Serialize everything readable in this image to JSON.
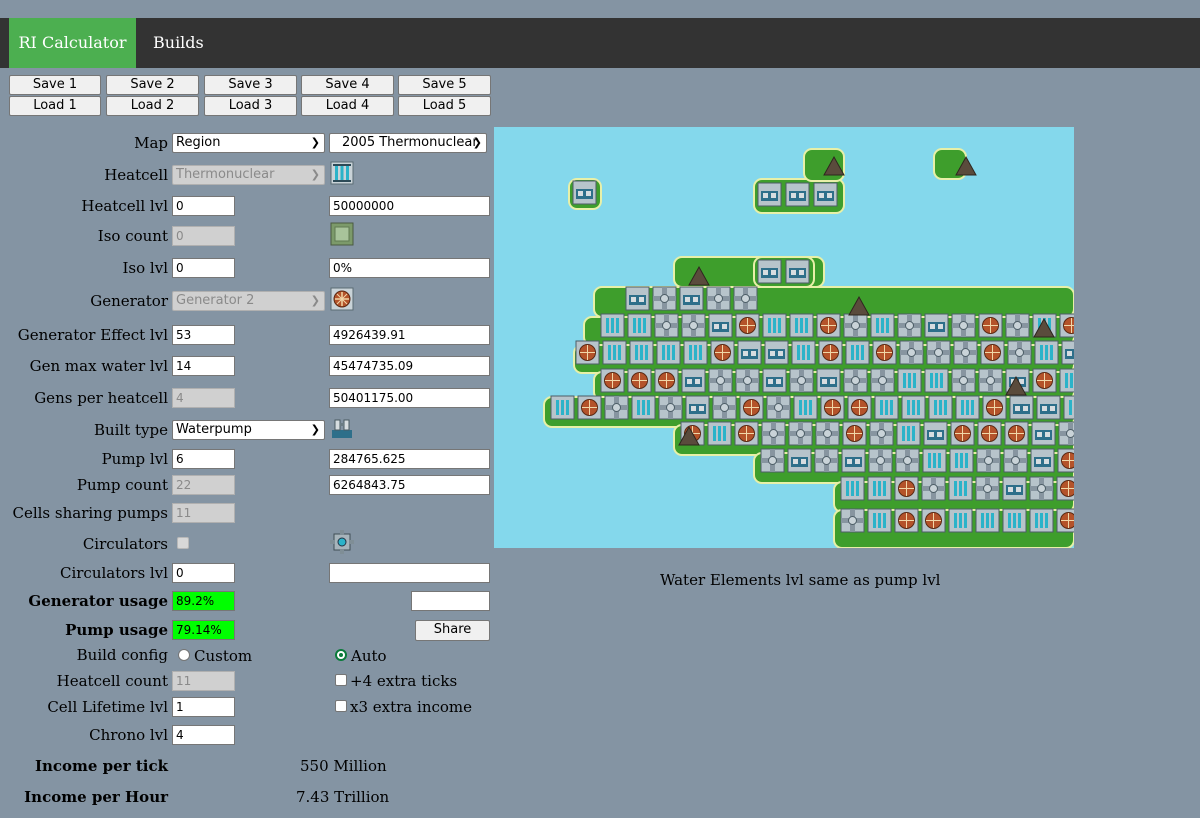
{
  "nav": {
    "calculator": "RI Calculator",
    "builds": "Builds"
  },
  "saves": [
    "Save 1",
    "Save 2",
    "Save 3",
    "Save 4",
    "Save 5"
  ],
  "loads": [
    "Load 1",
    "Load 2",
    "Load 3",
    "Load 4",
    "Load 5"
  ],
  "map": {
    "label": "Map",
    "type": "Region",
    "preset": "2005 Thermonuclear"
  },
  "heatcell": {
    "label": "Heatcell",
    "value": "Thermonuclear",
    "icon": "heatcell-icon"
  },
  "heatcell_lvl": {
    "label": "Heatcell lvl",
    "value": "0",
    "result": "50000000"
  },
  "iso_count": {
    "label": "Iso count",
    "value": "0",
    "icon": "isolator-icon"
  },
  "iso_lvl": {
    "label": "Iso lvl",
    "value": "0",
    "result": "0%"
  },
  "generator": {
    "label": "Generator",
    "value": "Generator 2",
    "icon": "generator-icon"
  },
  "gen_effect": {
    "label": "Generator Effect lvl",
    "value": "53",
    "result": "4926439.91"
  },
  "gen_water": {
    "label": "Gen max water lvl",
    "value": "14",
    "result": "45474735.09"
  },
  "gens_per_cell": {
    "label": "Gens per heatcell",
    "value": "4",
    "result": "50401175.00"
  },
  "built_type": {
    "label": "Built type",
    "value": "Waterpump",
    "icon": "waterpump-icon"
  },
  "pump_lvl": {
    "label": "Pump lvl",
    "value": "6",
    "result": "284765.625"
  },
  "pump_count": {
    "label": "Pump count",
    "value": "22",
    "result": "6264843.75"
  },
  "cells_sharing": {
    "label": "Cells sharing pumps",
    "value": "11"
  },
  "circulators": {
    "label": "Circulators",
    "icon": "circulator-icon"
  },
  "circ_lvl": {
    "label": "Circulators lvl",
    "value": "0",
    "result": ""
  },
  "gen_usage": {
    "label": "Generator usage",
    "value": "89.2%",
    "color": "#00ff00"
  },
  "pump_usage": {
    "label": "Pump usage",
    "value": "79.14%",
    "color": "#00ff00"
  },
  "build_config": {
    "label": "Build config",
    "custom": "Custom",
    "auto": "Auto",
    "selected": "Auto"
  },
  "heatcell_count": {
    "label": "Heatcell count",
    "value": "11"
  },
  "extra_ticks": {
    "label": "+4 extra ticks",
    "checked": false
  },
  "cell_lifetime": {
    "label": "Cell Lifetime lvl",
    "value": "1"
  },
  "extra_income": {
    "label": "x3 extra income",
    "checked": false
  },
  "chrono": {
    "label": "Chrono lvl",
    "value": "4"
  },
  "share": {
    "label": "Share",
    "value": ""
  },
  "note": "Water Elements lvl same as pump lvl",
  "income_tick": {
    "label": "Income per tick",
    "value": "550 Million"
  },
  "income_hour": {
    "label": "Income per Hour",
    "value": "7.43 Trillion"
  },
  "colors": {
    "accent": "#4caf50",
    "navbar": "#333333",
    "background": "#8494a3",
    "water": "#84d8ec",
    "grass": "#3e9e2c",
    "usage_ok": "#00ff00"
  }
}
